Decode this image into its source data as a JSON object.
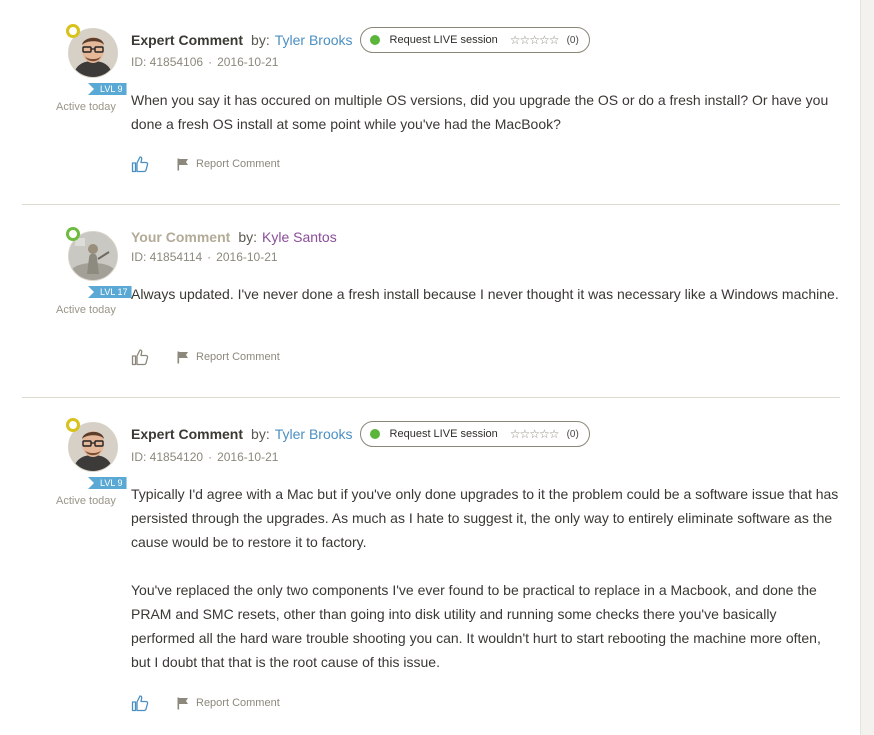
{
  "comments": [
    {
      "type_label": "Expert Comment",
      "by_label": "by:",
      "author": "Tyler Brooks",
      "live_button": "Request LIVE session",
      "rating_count": "(0)",
      "id_label": "ID: 41854106",
      "date": "2016-10-21",
      "level": "LVL 9",
      "activity": "Active today",
      "paragraphs": [
        "When you say it has occured on multiple OS versions, did you upgrade the OS or do a fresh install? Or have you done a fresh OS install at some point while you've had the MacBook?"
      ],
      "report_label": "Report Comment",
      "icons": {
        "like": "thumbs-up-icon",
        "report": "flag-icon",
        "status": "chat-bubble-icon"
      }
    },
    {
      "type_label": "Your Comment",
      "by_label": "by:",
      "author": "Kyle Santos",
      "id_label": "ID: 41854114",
      "date": "2016-10-21",
      "level": "LVL 17",
      "activity": "Active today",
      "paragraphs": [
        "Always updated.  I've never done a fresh install because I never thought it was necessary like a Windows machine."
      ],
      "report_label": "Report Comment",
      "icons": {
        "like": "thumbs-up-icon",
        "report": "flag-icon",
        "status": "chat-bubble-icon"
      }
    },
    {
      "type_label": "Expert Comment",
      "by_label": "by:",
      "author": "Tyler Brooks",
      "live_button": "Request LIVE session",
      "rating_count": "(0)",
      "id_label": "ID: 41854120",
      "date": "2016-10-21",
      "level": "LVL 9",
      "activity": "Active today",
      "paragraphs": [
        "Typically I'd agree with a Mac but if you've only done upgrades to it the problem could be a software issue that has persisted through the upgrades. As much as I hate to suggest it, the only way to entirely eliminate software as the cause would be to restore it to factory.",
        "You've replaced the only two components I've ever found to be practical to replace in a Macbook, and done the PRAM and SMC resets, other than going into disk utility and running some checks there you've basically performed all the hard ware trouble shooting you can. It wouldn't hurt to start rebooting the machine more often, but I doubt that that is the root cause of this issue."
      ],
      "report_label": "Report Comment",
      "icons": {
        "like": "thumbs-up-icon",
        "report": "flag-icon",
        "status": "chat-bubble-icon"
      }
    }
  ],
  "colors": {
    "expert_author": "#4b8fc2",
    "own_author": "#8a4d99",
    "level_badge": "#5aa8d4",
    "live_dot": "#5ab53a",
    "expert_status": "#d8c21a",
    "own_status": "#6dbb3f"
  }
}
